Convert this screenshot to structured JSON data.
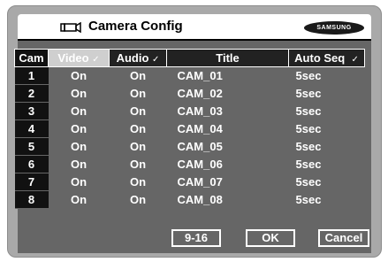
{
  "window": {
    "title": "Camera Config",
    "brand": "SAMSUNG"
  },
  "table": {
    "headers": {
      "cam": "Cam",
      "video": "Video",
      "audio": "Audio",
      "title": "Title",
      "seq": "Auto Seq"
    },
    "check": "✓",
    "rows": [
      {
        "cam": "1",
        "video": "On",
        "audio": "On",
        "title": "CAM_01",
        "seq": "5sec"
      },
      {
        "cam": "2",
        "video": "On",
        "audio": "On",
        "title": "CAM_02",
        "seq": "5sec"
      },
      {
        "cam": "3",
        "video": "On",
        "audio": "On",
        "title": "CAM_03",
        "seq": "5sec"
      },
      {
        "cam": "4",
        "video": "On",
        "audio": "On",
        "title": "CAM_04",
        "seq": "5sec"
      },
      {
        "cam": "5",
        "video": "On",
        "audio": "On",
        "title": "CAM_05",
        "seq": "5sec"
      },
      {
        "cam": "6",
        "video": "On",
        "audio": "On",
        "title": "CAM_06",
        "seq": "5sec"
      },
      {
        "cam": "7",
        "video": "On",
        "audio": "On",
        "title": "CAM_07",
        "seq": "5sec"
      },
      {
        "cam": "8",
        "video": "On",
        "audio": "On",
        "title": "CAM_08",
        "seq": "5sec"
      }
    ]
  },
  "buttons": {
    "next_page": "9-16",
    "ok": "OK",
    "cancel": "Cancel"
  },
  "colors": {
    "panel": "#666666",
    "frame": "#a9a9a9",
    "header_bg": "#ffffff",
    "selected_header": "#cfcfcf"
  },
  "icons": {
    "camera": "camera-icon"
  }
}
